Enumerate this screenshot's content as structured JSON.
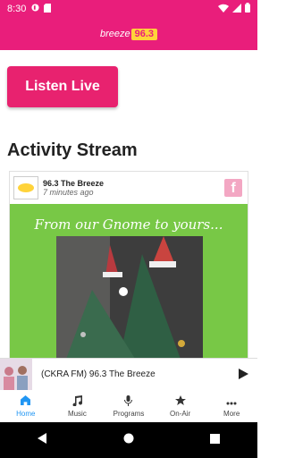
{
  "status_bar": {
    "time": "8:30"
  },
  "app_bar": {
    "logo_text": "breeze",
    "logo_number": "96.3"
  },
  "listen_button": {
    "label": "Listen Live"
  },
  "activity": {
    "title": "Activity Stream",
    "post": {
      "author": "96.3 The Breeze",
      "time": "7 minutes ago",
      "source_icon": "facebook-icon",
      "caption": "From our Gnome to yours..."
    }
  },
  "mini_player": {
    "title": "(CKRA FM) 96.3 The Breeze"
  },
  "bottom_nav": {
    "items": [
      {
        "label": "Home",
        "icon": "home-icon"
      },
      {
        "label": "Music",
        "icon": "music-note-icon"
      },
      {
        "label": "Programs",
        "icon": "microphone-icon"
      },
      {
        "label": "On-Air",
        "icon": "star-icon"
      },
      {
        "label": "More",
        "icon": "more-icon"
      }
    ]
  },
  "colors": {
    "brand": "#e91e7b",
    "accent_blue": "#2196f3",
    "post_background": "#78c846"
  }
}
